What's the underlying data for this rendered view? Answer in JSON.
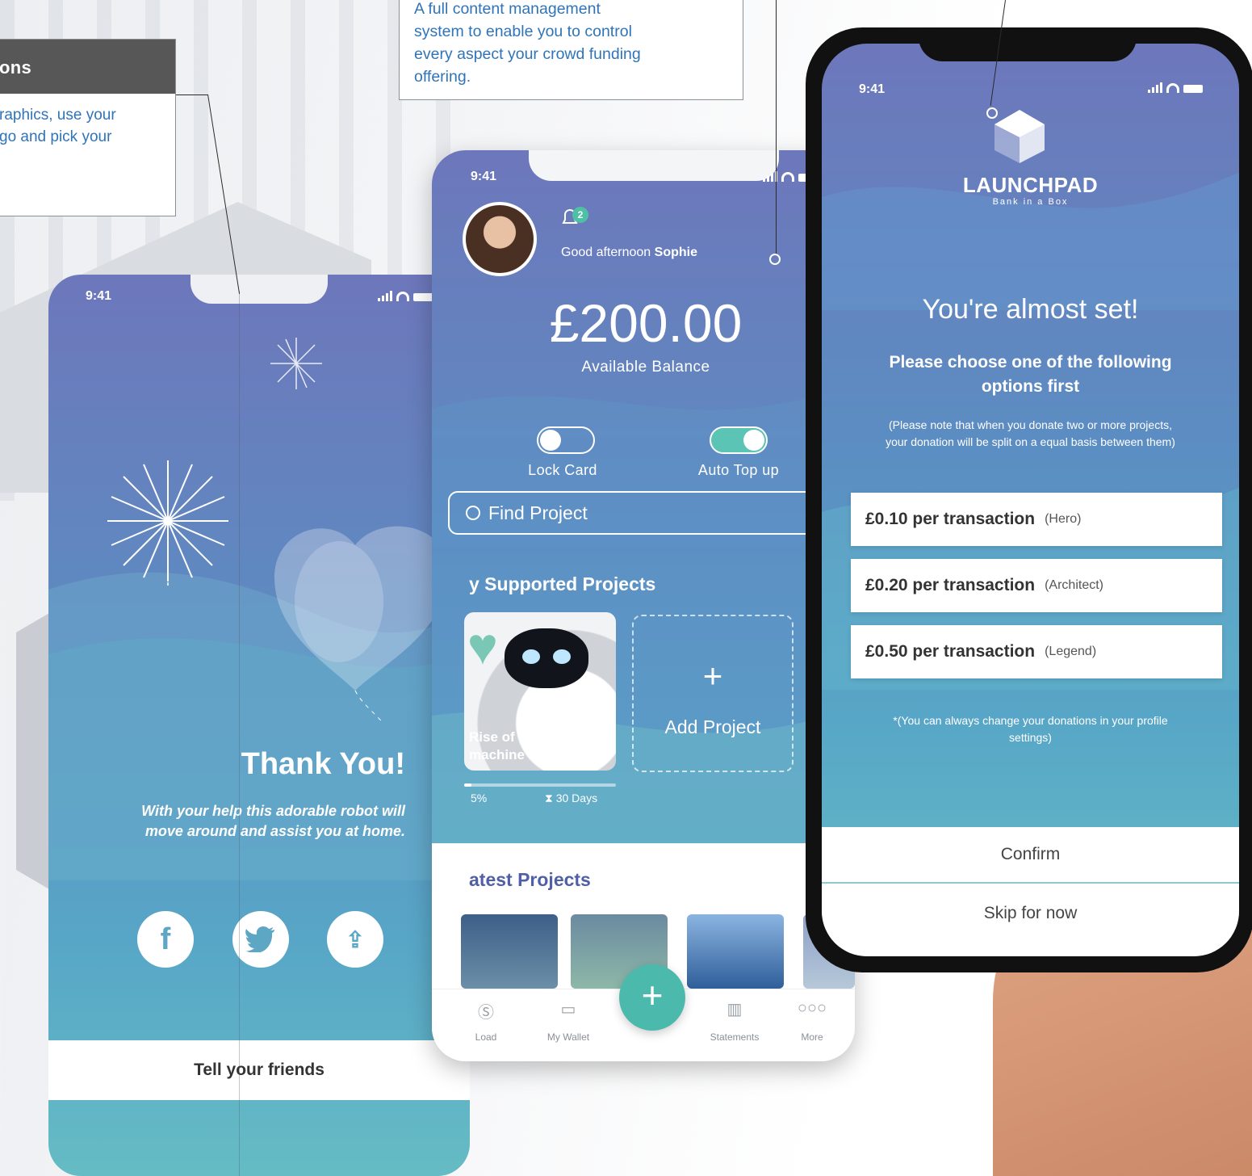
{
  "callouts": {
    "left_title": "ons",
    "left_text": "raphics, use your\ngo and pick your",
    "top_text": "A full content management\nsystem to enable you to control\nevery aspect your crowd funding\noffering."
  },
  "status_time": "9:41",
  "thank_you": {
    "title": "Thank You!",
    "text": "With your help this adorable robot will\nmove around and assist you at home.",
    "social": {
      "facebook": "f",
      "twitter": "t",
      "share": "⇪"
    },
    "tell_friends": "Tell your friends"
  },
  "dashboard": {
    "notification_count": "2",
    "greeting_prefix": "Good afternoon",
    "greeting_name": "Sophie",
    "balance": "£200.00",
    "balance_label": "Available Balance",
    "toggles": [
      {
        "label": "Lock Card",
        "on": false
      },
      {
        "label": "Auto Top up",
        "on": true
      }
    ],
    "search_placeholder": "Find Project",
    "supported_title": "y Supported Projects",
    "card": {
      "label": "Rise of the\nmachine",
      "percent": "5%",
      "days": "⧗ 30 Days",
      "progress": 0.05
    },
    "add_project": "Add Project",
    "latest_title": "atest Projects",
    "tabs": [
      "Load",
      "My Wallet",
      "Statements",
      "More"
    ],
    "accent": "#4cb9ad"
  },
  "onboarding": {
    "logo": "LAUNCHPAD",
    "logo_sub": "Bank in a Box",
    "title": "You're almost set!",
    "subtitle": "Please choose one of the following options first",
    "note": "(Please note that when you donate two or more projects, your donation will be split on a equal basis between them)",
    "options": [
      {
        "amount": "£0.10 per transaction",
        "tier": "(Hero)"
      },
      {
        "amount": "£0.20 per transaction",
        "tier": "(Architect)"
      },
      {
        "amount": "£0.50 per transaction",
        "tier": "(Legend)"
      }
    ],
    "footnote": "*(You can always change your donations in your profile settings)",
    "confirm": "Confirm",
    "skip": "Skip for now"
  }
}
